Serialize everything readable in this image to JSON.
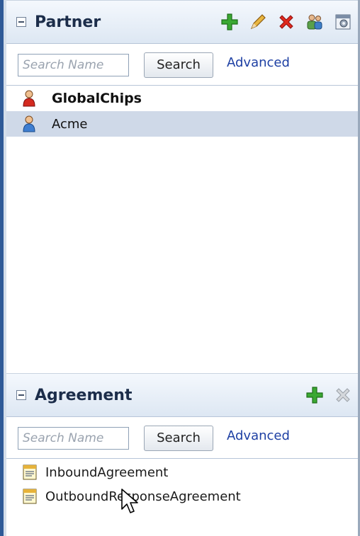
{
  "partner": {
    "title": "Partner",
    "toolbar": [
      "add-icon",
      "edit-icon",
      "delete-icon",
      "users-icon",
      "properties-icon"
    ],
    "search_placeholder": "Search Name",
    "search_label": "Search",
    "advanced_label": "Advanced",
    "items": [
      {
        "name": "GlobalChips",
        "icon": "person-red-icon",
        "selected": false
      },
      {
        "name": "Acme",
        "icon": "person-blue-icon",
        "selected": true
      }
    ]
  },
  "agreement": {
    "title": "Agreement",
    "toolbar": [
      "add-icon",
      "delete-disabled-icon"
    ],
    "search_placeholder": "Search Name",
    "search_label": "Search",
    "advanced_label": "Advanced",
    "items": [
      {
        "name": "InboundAgreement",
        "icon": "agreement-doc-icon"
      },
      {
        "name": "OutboundResponseAgreement",
        "icon": "agreement-doc-icon"
      }
    ]
  },
  "colors": {
    "header_bg": "#dde7f3",
    "selected_row": "#cfd9e8",
    "link": "#1d3fa3",
    "rail": "#2f5a97"
  }
}
